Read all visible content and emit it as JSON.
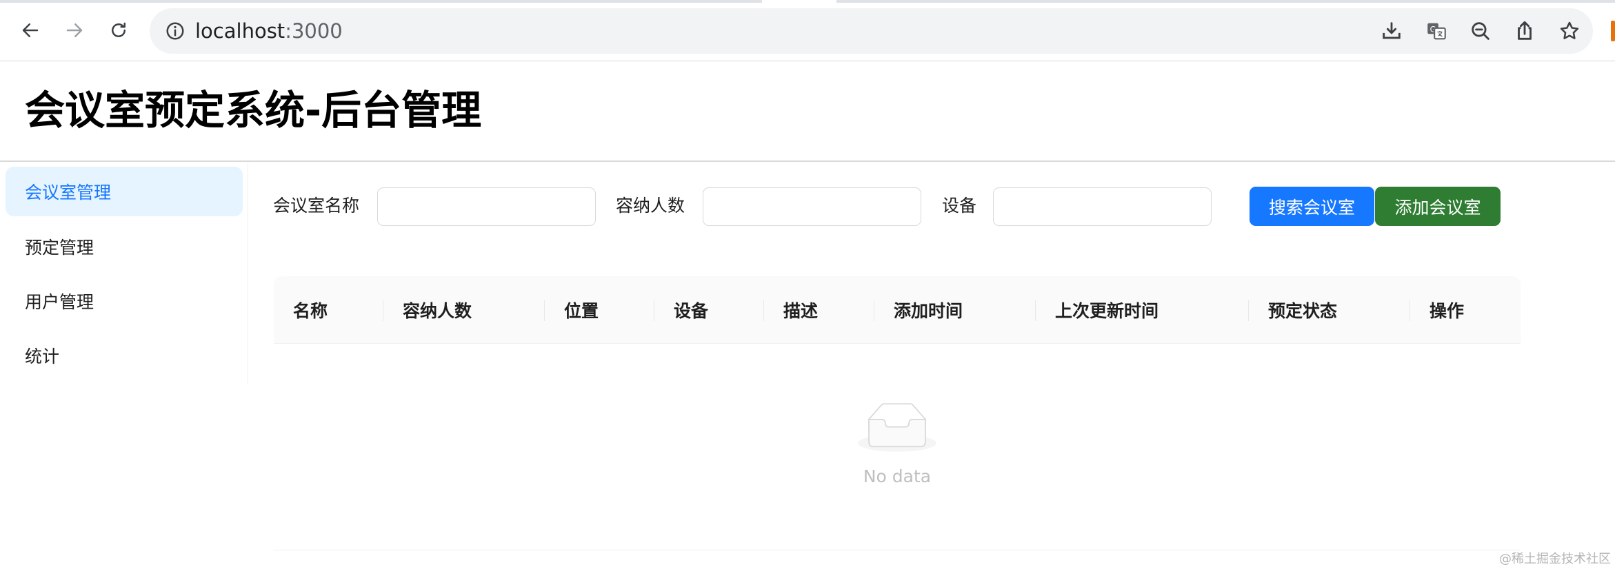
{
  "browser": {
    "url_host": "localhost",
    "url_port": ":3000"
  },
  "app": {
    "title": "会议室预定系统-后台管理"
  },
  "sidebar": {
    "items": [
      {
        "label": "会议室管理",
        "active": true
      },
      {
        "label": "预定管理",
        "active": false
      },
      {
        "label": "用户管理",
        "active": false
      },
      {
        "label": "统计",
        "active": false
      }
    ]
  },
  "search_form": {
    "name_label": "会议室名称",
    "name_value": "",
    "capacity_label": "容纳人数",
    "capacity_value": "",
    "equipment_label": "设备",
    "equipment_value": "",
    "search_button": "搜索会议室",
    "add_button": "添加会议室"
  },
  "table": {
    "columns": [
      "名称",
      "容纳人数",
      "位置",
      "设备",
      "描述",
      "添加时间",
      "上次更新时间",
      "预定状态",
      "操作"
    ],
    "empty_text": "No data"
  },
  "watermark": "@稀土掘金技术社区",
  "colors": {
    "primary": "#1677ff",
    "add_button": "#2e7d32",
    "active_menu_bg": "#e6f4ff"
  }
}
